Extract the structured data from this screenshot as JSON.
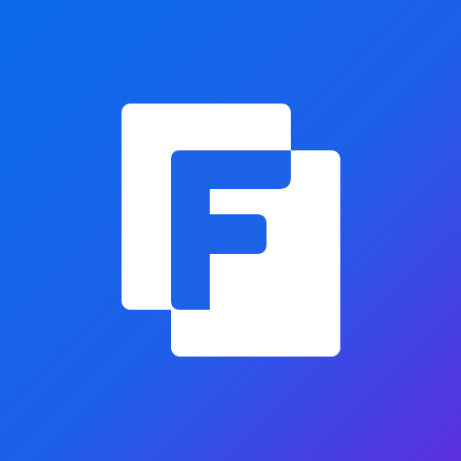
{
  "icon": {
    "name": "app-logo",
    "glyph": "F",
    "colors": {
      "gradient_start": "#0A6BEB",
      "gradient_mid": "#1F5FE8",
      "gradient_end": "#5B2FE0",
      "sheet": "#FFFFFF",
      "letter": "#1C63E8"
    }
  }
}
